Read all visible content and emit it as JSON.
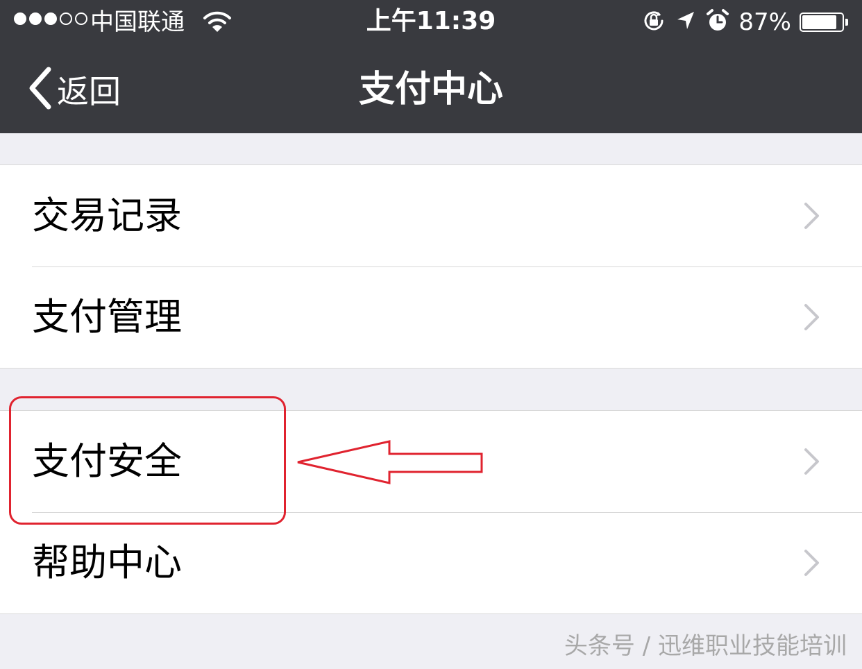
{
  "status_bar": {
    "carrier": "中国联通",
    "time": "上午11:39",
    "battery_percent": "87%",
    "battery_level": 0.87,
    "signal_strength": 3,
    "signal_max": 5,
    "icons": [
      "wifi-icon",
      "rotation-lock-icon",
      "location-arrow-icon",
      "alarm-icon",
      "battery-icon"
    ]
  },
  "nav": {
    "back_label": "返回",
    "title": "支付中心"
  },
  "menu": {
    "group1": [
      {
        "label": "交易记录"
      },
      {
        "label": "支付管理"
      }
    ],
    "group2": [
      {
        "label": "支付安全"
      },
      {
        "label": "帮助中心"
      }
    ]
  },
  "annotation": {
    "highlighted_item": "支付安全",
    "color": "#e0232f"
  },
  "watermark": "头条号 / 迅维职业技能培训",
  "colors": {
    "nav_background": "#393a3f",
    "page_background": "#efeff4",
    "chevron": "#c7c7cc"
  }
}
